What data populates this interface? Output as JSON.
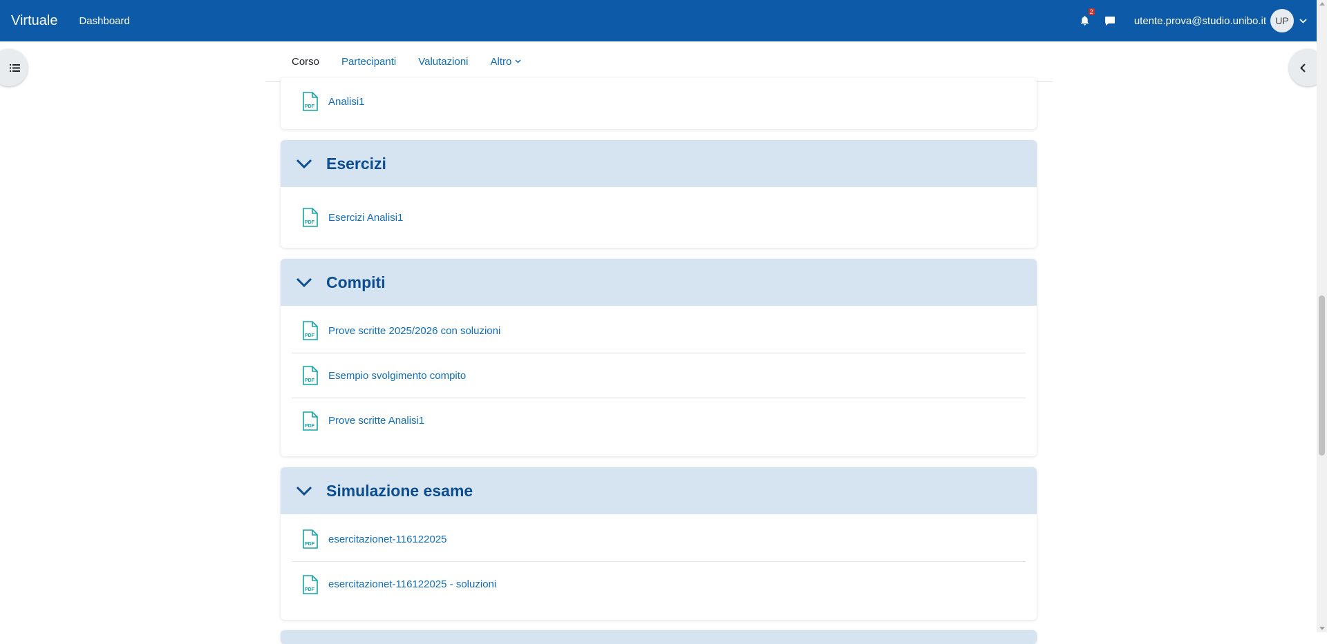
{
  "navbar": {
    "brand": "Virtuale",
    "dashboard_link": "Dashboard",
    "notification_count": "2",
    "user_email": "utente.prova@studio.unibo.it",
    "avatar_initials": "UP"
  },
  "secondary_nav": {
    "tabs": [
      {
        "label": "Corso",
        "active": true
      },
      {
        "label": "Partecipanti",
        "active": false
      },
      {
        "label": "Valutazioni",
        "active": false
      },
      {
        "label": "Altro",
        "active": false
      }
    ]
  },
  "sections": [
    {
      "title": "",
      "items": [
        "Analisi1"
      ]
    },
    {
      "title": "Esercizi",
      "items": [
        "Esercizi Analisi1"
      ]
    },
    {
      "title": "Compiti",
      "items": [
        "Prove scritte 2025/2026 con soluzioni",
        "Esempio svolgimento compito",
        "Prove scritte Analisi1"
      ]
    },
    {
      "title": "Simulazione esame",
      "items": [
        "esercitazionet-116122025",
        "esercitazionet-116122025 - soluzioni"
      ]
    }
  ],
  "icons": {
    "pdf": "pdf-file-icon",
    "bell": "bell-icon",
    "messages": "chat-bubble-icon",
    "drawer_left": "course-index-icon",
    "drawer_right": "chevron-left-icon"
  },
  "colors": {
    "navbar": "#0c5aa8",
    "section_header": "#d6e4f2",
    "section_title": "#0b4d90",
    "link": "#0f6cbf",
    "pdf_icon": "#13a5a5"
  }
}
